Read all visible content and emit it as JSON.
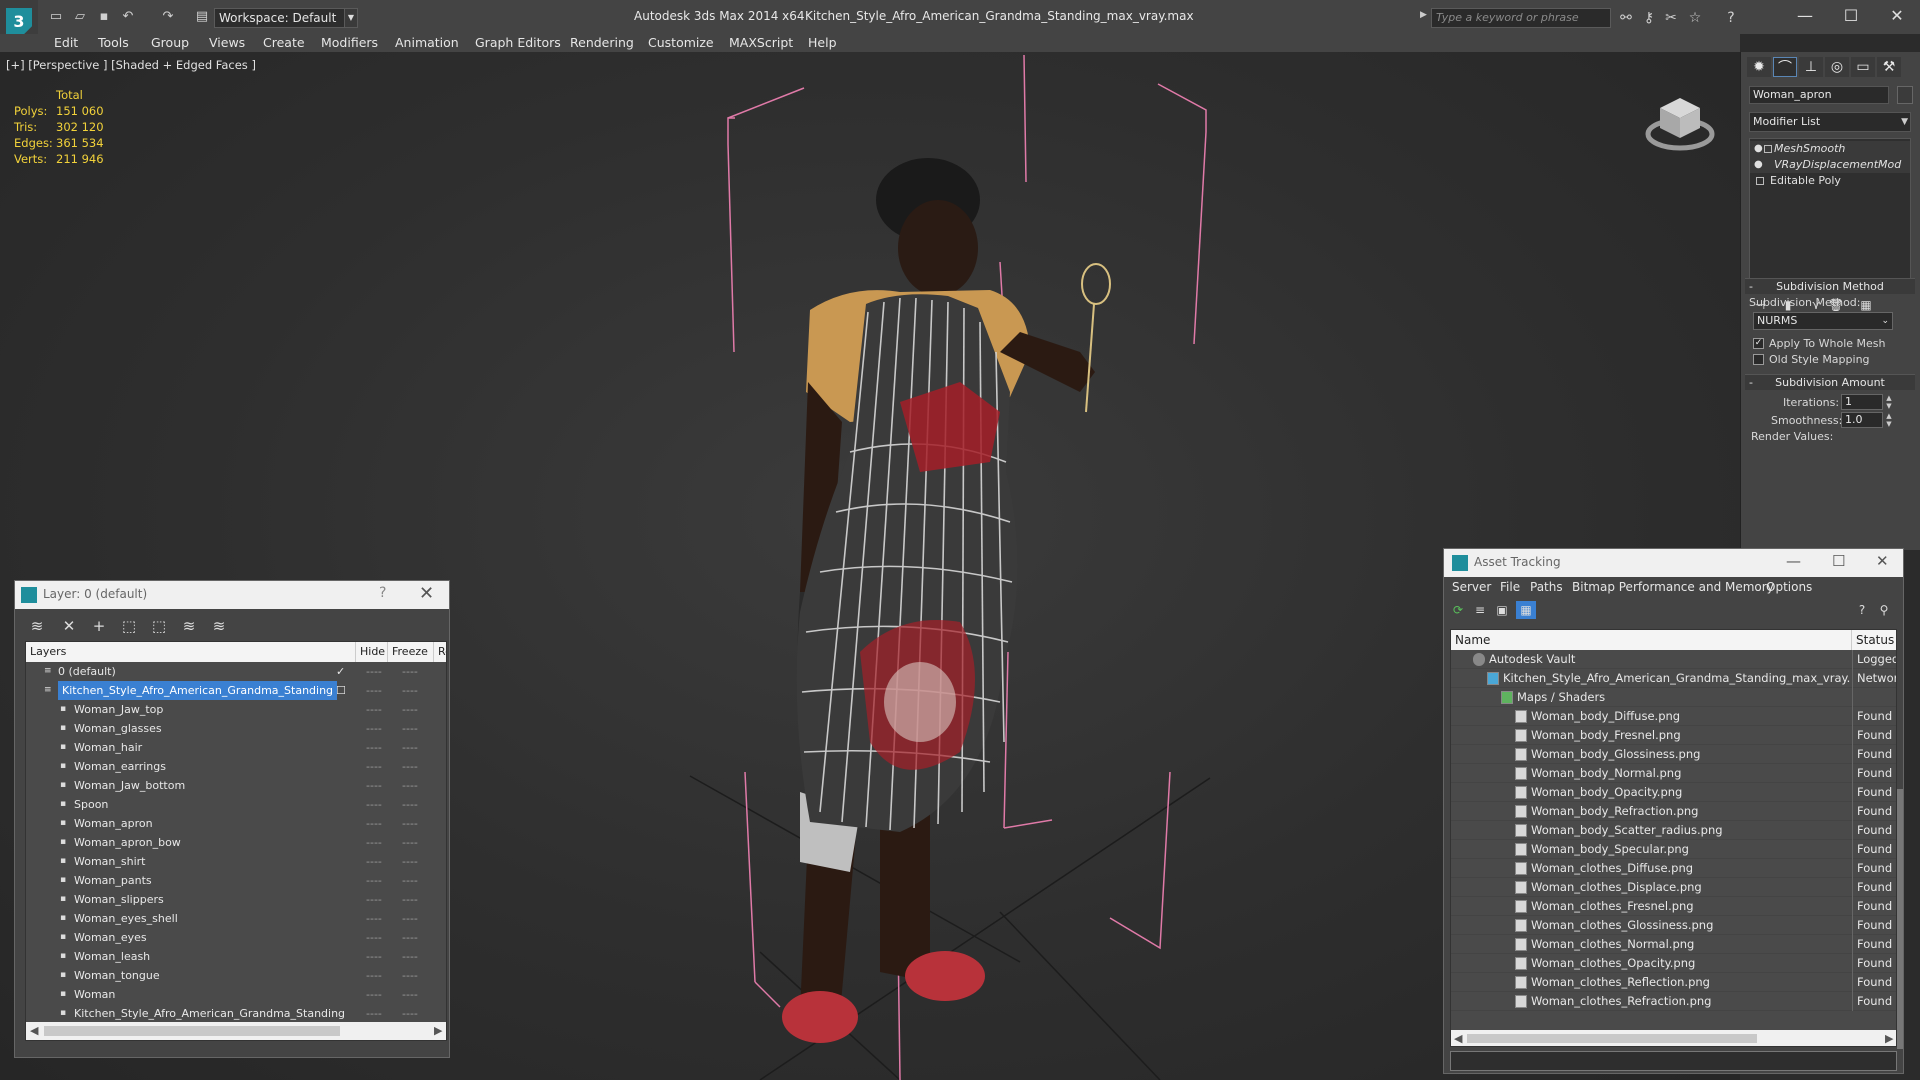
{
  "titlebar": {
    "workspace": "Workspace: Default",
    "app_title": "Autodesk 3ds Max  2014 x64",
    "file_title": "Kitchen_Style_Afro_American_Grandma_Standing_max_vray.max",
    "search_placeholder": "Type a keyword or phrase"
  },
  "menu": [
    "Edit",
    "Tools",
    "Group",
    "Views",
    "Create",
    "Modifiers",
    "Animation",
    "Graph Editors",
    "Rendering",
    "Customize",
    "MAXScript",
    "Help"
  ],
  "viewport": {
    "label": "[+] [Perspective ] [Shaded + Edged Faces ]",
    "stats": {
      "header": "Total",
      "rows": [
        {
          "k": "Polys:",
          "v": "151 060"
        },
        {
          "k": "Tris:",
          "v": "302 120"
        },
        {
          "k": "Edges:",
          "v": "361 534"
        },
        {
          "k": "Verts:",
          "v": "211 946"
        }
      ]
    }
  },
  "command_panel": {
    "object_name": "Woman_apron",
    "modifier_list": "Modifier List",
    "stack": [
      "MeshSmooth",
      "VRayDisplacementMod",
      "Editable Poly"
    ],
    "subdivision_method_header": "Subdivision Method",
    "subdivision_method_label": "Subdivision Method:",
    "subdivision_method_value": "NURMS",
    "apply_whole_mesh": "Apply To Whole Mesh",
    "old_style_mapping": "Old Style Mapping",
    "subdivision_amount_header": "Subdivision Amount",
    "iterations_label": "Iterations:",
    "iterations_value": "1",
    "smoothness_label": "Smoothness:",
    "smoothness_value": "1.0",
    "render_values_label": "Render Values:"
  },
  "layer_window": {
    "title": "Layer: 0 (default)",
    "help": "?",
    "columns": [
      "Layers",
      "Hide",
      "Freeze",
      "Re"
    ],
    "rows": [
      {
        "name": "0 (default)",
        "level": 0,
        "check": true
      },
      {
        "name": "Kitchen_Style_Afro_American_Grandma_Standing",
        "level": 0,
        "selected": true
      },
      {
        "name": "Woman_Jaw_top",
        "level": 1
      },
      {
        "name": "Woman_glasses",
        "level": 1
      },
      {
        "name": "Woman_hair",
        "level": 1
      },
      {
        "name": "Woman_earrings",
        "level": 1
      },
      {
        "name": "Woman_Jaw_bottom",
        "level": 1
      },
      {
        "name": "Spoon",
        "level": 1
      },
      {
        "name": "Woman_apron",
        "level": 1
      },
      {
        "name": "Woman_apron_bow",
        "level": 1
      },
      {
        "name": "Woman_shirt",
        "level": 1
      },
      {
        "name": "Woman_pants",
        "level": 1
      },
      {
        "name": "Woman_slippers",
        "level": 1
      },
      {
        "name": "Woman_eyes_shell",
        "level": 1
      },
      {
        "name": "Woman_eyes",
        "level": 1
      },
      {
        "name": "Woman_leash",
        "level": 1
      },
      {
        "name": "Woman_tongue",
        "level": 1
      },
      {
        "name": "Woman",
        "level": 1
      },
      {
        "name": "Kitchen_Style_Afro_American_Grandma_Standing",
        "level": 1
      }
    ]
  },
  "asset_window": {
    "title": "Asset Tracking",
    "menu": [
      "Server",
      "File",
      "Paths",
      "Bitmap Performance and Memory",
      "Options"
    ],
    "columns": [
      "Name",
      "Status"
    ],
    "rows": [
      {
        "name": "Autodesk Vault",
        "level": 0,
        "status": "Logged O"
      },
      {
        "name": "Kitchen_Style_Afro_American_Grandma_Standing_max_vray.max",
        "level": 1,
        "status": "Network"
      },
      {
        "name": "Maps / Shaders",
        "level": 2,
        "status": ""
      },
      {
        "name": "Woman_body_Diffuse.png",
        "level": 3,
        "status": "Found"
      },
      {
        "name": "Woman_body_Fresnel.png",
        "level": 3,
        "status": "Found"
      },
      {
        "name": "Woman_body_Glossiness.png",
        "level": 3,
        "status": "Found"
      },
      {
        "name": "Woman_body_Normal.png",
        "level": 3,
        "status": "Found"
      },
      {
        "name": "Woman_body_Opacity.png",
        "level": 3,
        "status": "Found"
      },
      {
        "name": "Woman_body_Refraction.png",
        "level": 3,
        "status": "Found"
      },
      {
        "name": "Woman_body_Scatter_radius.png",
        "level": 3,
        "status": "Found"
      },
      {
        "name": "Woman_body_Specular.png",
        "level": 3,
        "status": "Found"
      },
      {
        "name": "Woman_clothes_Diffuse.png",
        "level": 3,
        "status": "Found"
      },
      {
        "name": "Woman_clothes_Displace.png",
        "level": 3,
        "status": "Found"
      },
      {
        "name": "Woman_clothes_Fresnel.png",
        "level": 3,
        "status": "Found"
      },
      {
        "name": "Woman_clothes_Glossiness.png",
        "level": 3,
        "status": "Found"
      },
      {
        "name": "Woman_clothes_Normal.png",
        "level": 3,
        "status": "Found"
      },
      {
        "name": "Woman_clothes_Opacity.png",
        "level": 3,
        "status": "Found"
      },
      {
        "name": "Woman_clothes_Reflection.png",
        "level": 3,
        "status": "Found"
      },
      {
        "name": "Woman_clothes_Refraction.png",
        "level": 3,
        "status": "Found"
      }
    ]
  },
  "colors": {
    "stats": "#f2d23a",
    "selection": "#3a80d2",
    "bbox": "#e07aa8",
    "accent": "#1f8e9c"
  }
}
